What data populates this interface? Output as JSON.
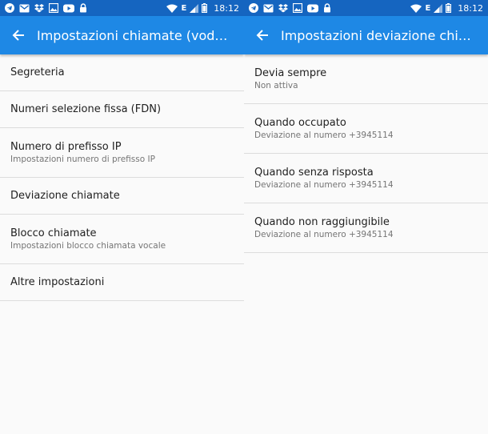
{
  "status_bar": {
    "time": "18:12",
    "network": "E",
    "notification_icons": [
      "telegram-icon",
      "gmail-icon",
      "dropbox-icon",
      "gallery-icon",
      "youtube-icon",
      "lock-icon"
    ],
    "colors": {
      "status_bg": "#1565c0"
    }
  },
  "left_screen": {
    "title": "Impostazioni chiamate (voda…",
    "items": [
      {
        "primary": "Segreteria"
      },
      {
        "primary": "Numeri selezione fissa (FDN)"
      },
      {
        "primary": "Numero di prefisso IP",
        "secondary": "Impostazioni numero di prefisso IP"
      },
      {
        "primary": "Deviazione chiamate"
      },
      {
        "primary": "Blocco chiamate",
        "secondary": "Impostazioni blocco chiamata vocale"
      },
      {
        "primary": "Altre impostazioni"
      }
    ]
  },
  "right_screen": {
    "title": "Impostazioni deviazione chia…",
    "items": [
      {
        "primary": "Devia sempre",
        "secondary": "Non attiva"
      },
      {
        "primary": "Quando occupato",
        "secondary": "Deviazione al numero +3945114"
      },
      {
        "primary": "Quando senza risposta",
        "secondary": "Deviazione al numero +3945114"
      },
      {
        "primary": "Quando non raggiungibile",
        "secondary": "Deviazione al numero +3945114"
      }
    ]
  },
  "colors": {
    "appbar": "#1e88e5",
    "status_bar": "#1565c0",
    "background": "#fafafa"
  }
}
